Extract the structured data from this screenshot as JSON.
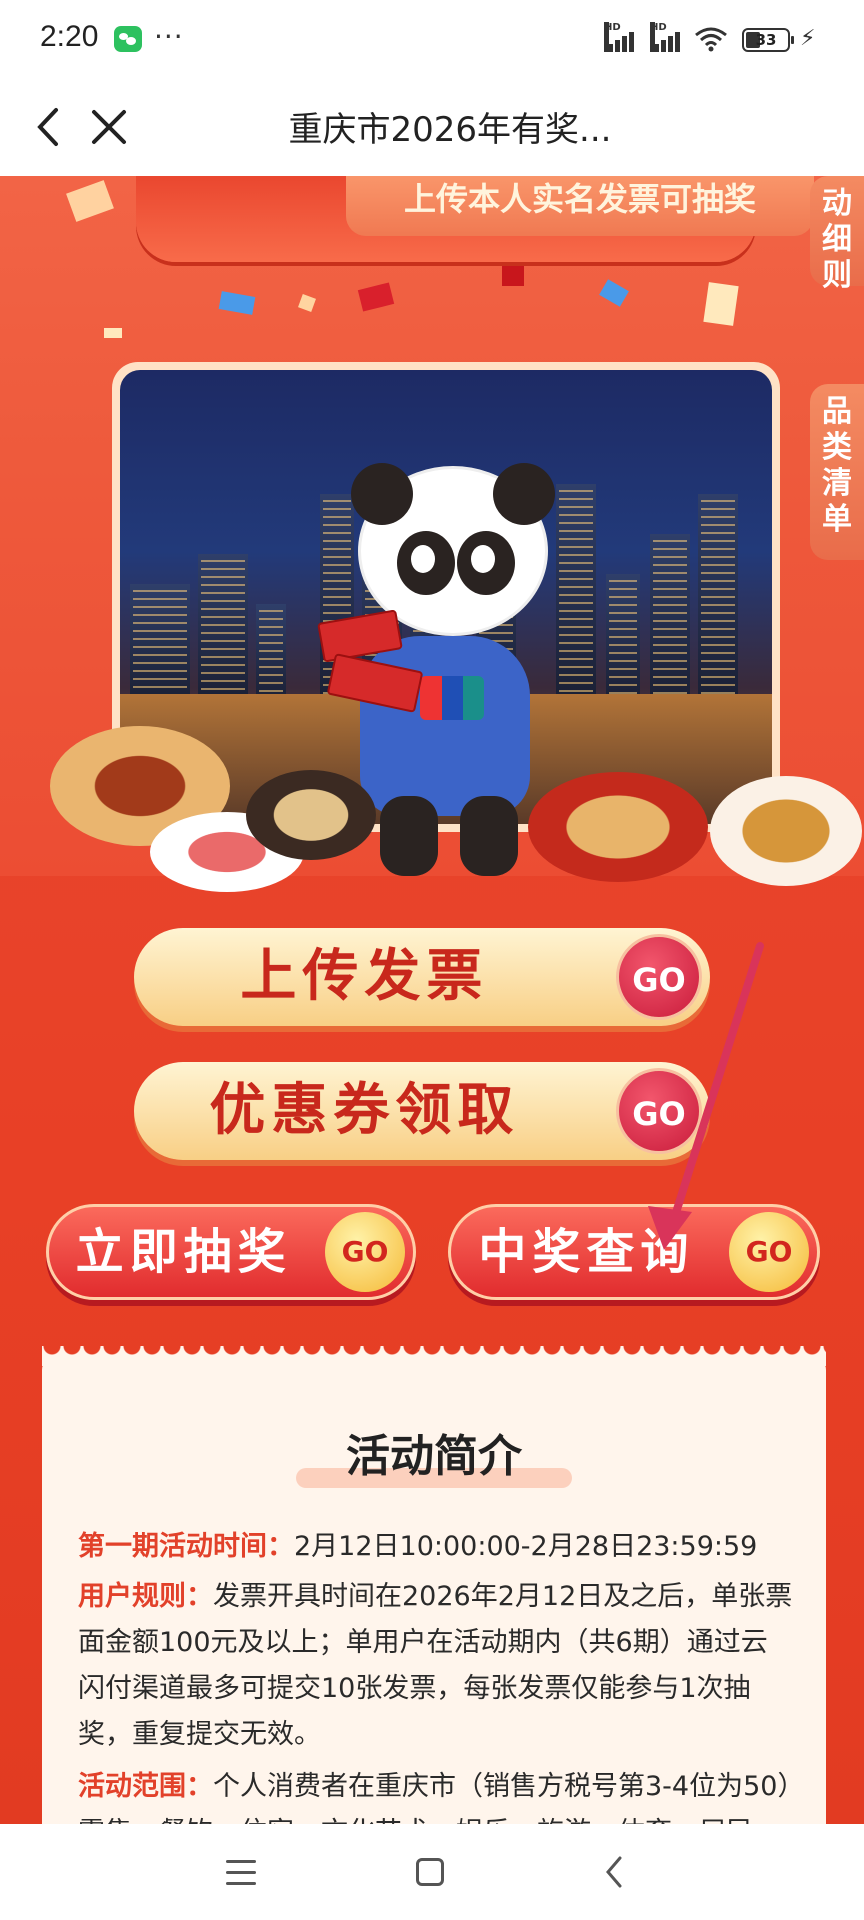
{
  "status_bar": {
    "time": "2:20",
    "dots": "···",
    "battery": "33",
    "network_1": "HD",
    "network_2": "HD"
  },
  "navbar": {
    "title": "重庆市2026年有奖..."
  },
  "banner": {
    "ribbon_text": "上传本人实名发票可抽奖",
    "side_tab_rules": "动细则",
    "side_tab_list": "品类清单"
  },
  "buttons": {
    "upload": "上传发票",
    "coupon": "优惠券领取",
    "draw": "立即抽奖",
    "query": "中奖查询",
    "go": "GO"
  },
  "intro": {
    "title": "活动简介",
    "period_label": "第一期活动时间：",
    "period_value": "2月12日10:00:00-2月28日23:59:59",
    "rules_label": "用户规则：",
    "rules_value": "发票开具时间在2026年2月12日及之后，单张票面金额100元及以上；单用户在活动期内（共6期）通过云闪付渠道最多可提交10张发票，每张发票仅能参与1次抽奖，重复提交无效。",
    "scope_label": "活动范围：",
    "scope_value": "个人消费者在重庆市（销售方税号第3-4位为50）零售、餐饮、住宿、文化艺术、娱乐、旅游、体育、居民"
  },
  "colors": {
    "brand_red": "#e84026",
    "gold": "#f8cf85",
    "key_text": "#e2412a"
  }
}
